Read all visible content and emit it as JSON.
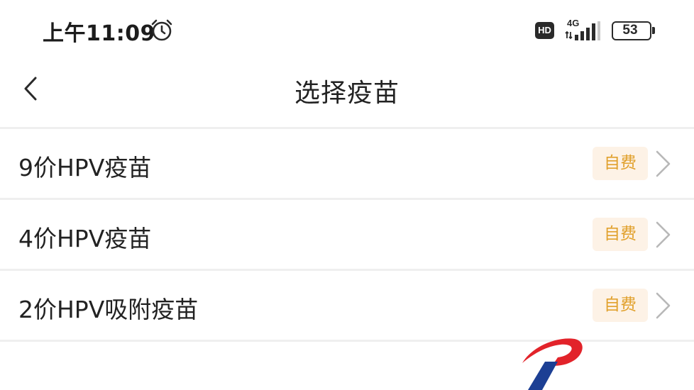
{
  "status_bar": {
    "time": "上午11:09",
    "hd_label": "HD",
    "network_type": "4G",
    "battery_level": "53",
    "icons": [
      "alarm-clock-icon",
      "hd-icon",
      "signal-icon",
      "battery-icon"
    ]
  },
  "nav": {
    "title": "选择疫苗",
    "back_icon": "chevron-left-icon"
  },
  "vaccines": [
    {
      "name": "9价HPV疫苗",
      "fee_label": "自费"
    },
    {
      "name": "4价HPV疫苗",
      "fee_label": "自费"
    },
    {
      "name": "2价HPV吸附疫苗",
      "fee_label": "自费"
    }
  ],
  "colors": {
    "fee_badge_text": "#e1a12d",
    "fee_badge_bg": "#fdf2e6",
    "divider": "#efefef",
    "logo_red": "#e2232a",
    "logo_blue": "#1c3f94"
  }
}
